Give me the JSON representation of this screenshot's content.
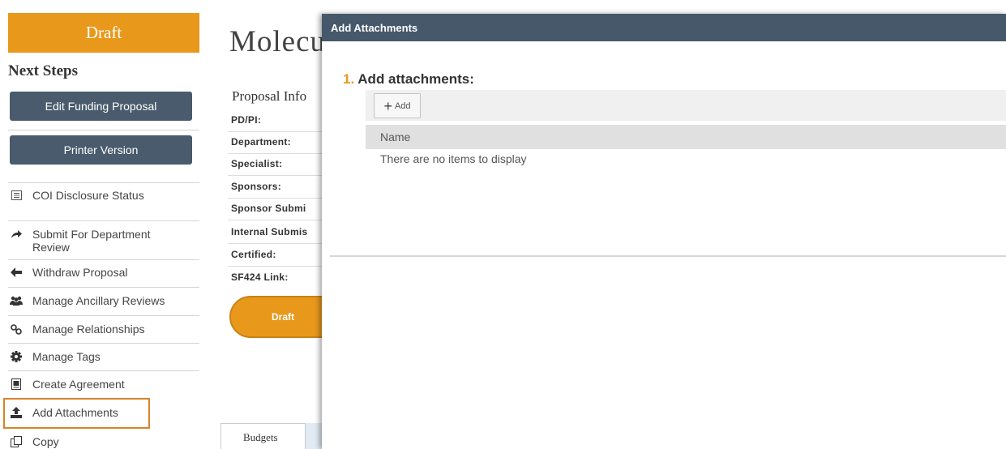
{
  "sidebar": {
    "state": "Draft",
    "next_steps_title": "Next Steps",
    "edit_button": "Edit Funding Proposal",
    "printer_button": "Printer Version",
    "actions": [
      {
        "label": "COI Disclosure Status",
        "icon": "list-icon"
      },
      {
        "label": "Submit For Department Review",
        "icon": "share-arrow-icon"
      },
      {
        "label": "Withdraw Proposal",
        "icon": "arrow-left-icon"
      },
      {
        "label": "Manage Ancillary Reviews",
        "icon": "users-icon"
      },
      {
        "label": "Manage Relationships",
        "icon": "link-icon"
      },
      {
        "label": "Manage Tags",
        "icon": "gear-icon"
      },
      {
        "label": "Create Agreement",
        "icon": "document-icon"
      },
      {
        "label": "Add Attachments",
        "icon": "upload-icon"
      },
      {
        "label": "Copy",
        "icon": "copy-icon"
      }
    ]
  },
  "main": {
    "title": "Molecu",
    "section_title": "Proposal Info",
    "fields": [
      "PD/PI:",
      "Department:",
      "Specialist:",
      "Sponsors:",
      "Sponsor Submi",
      "Internal Submis",
      "Certified:",
      "SF424 Link:"
    ],
    "workflow_state": "Draft",
    "tabs": [
      "Budgets"
    ]
  },
  "dialog": {
    "title": "Add Attachments",
    "step_number": "1.",
    "step_label": "Add attachments:",
    "add_button": "Add",
    "column_name": "Name",
    "empty_message": "There are no items to display"
  },
  "colors": {
    "accent": "#e8991c",
    "button": "#495b6c",
    "dialog_header": "#46596b",
    "highlight": "#d9822b"
  }
}
